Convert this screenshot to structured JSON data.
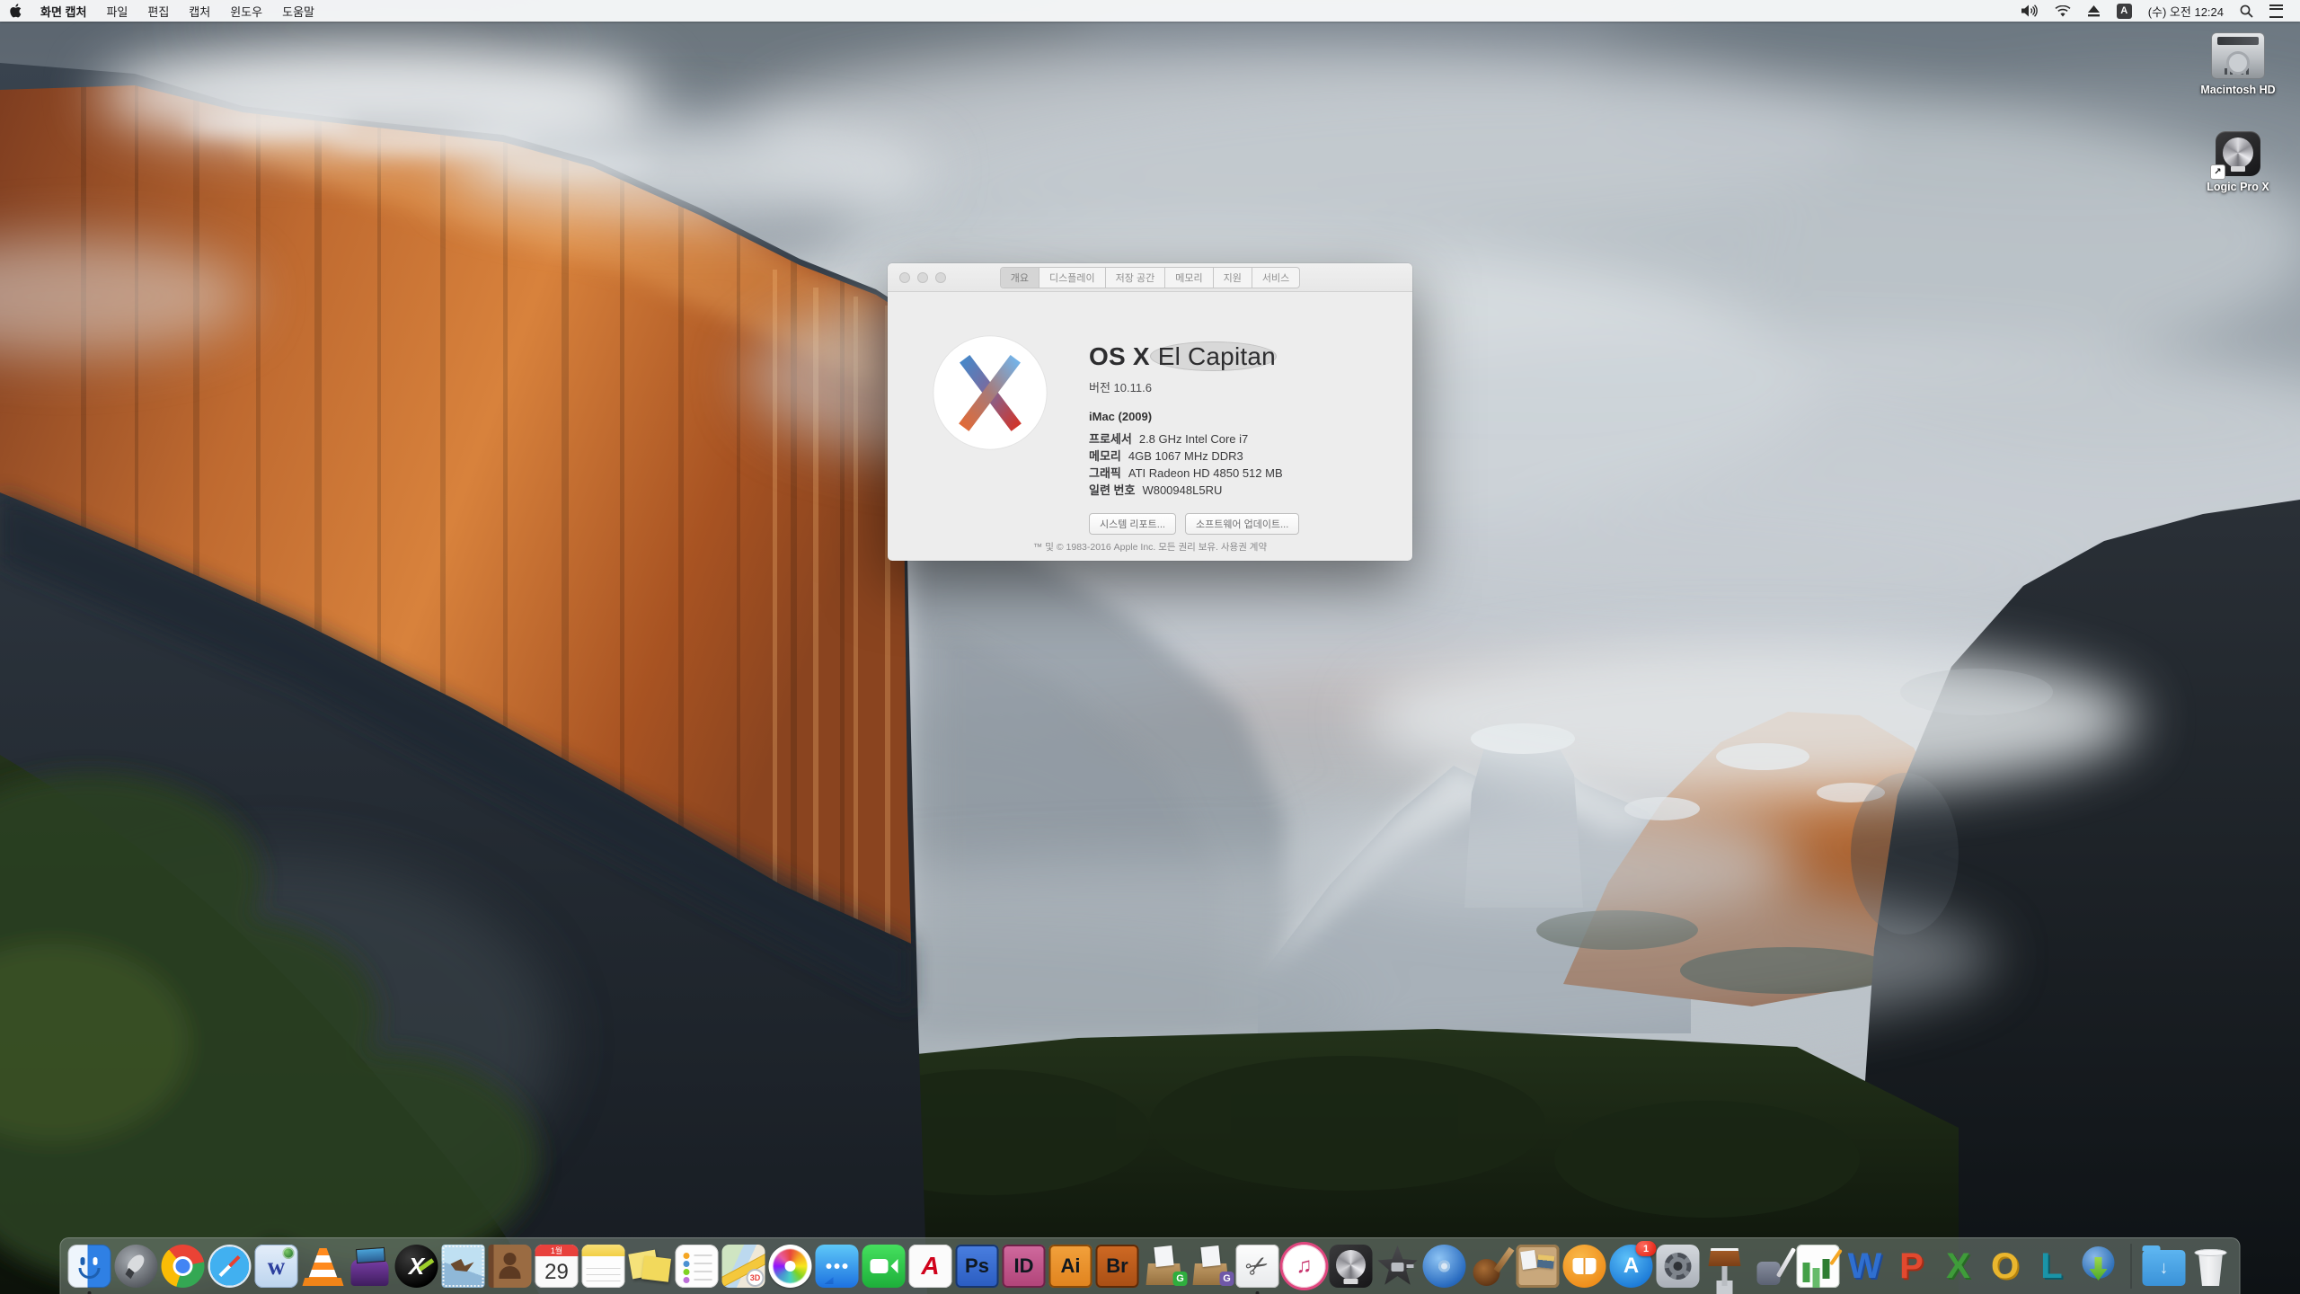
{
  "menu_bar": {
    "apple_icon": "apple-logo",
    "menus": [
      {
        "label": "화면 캡처",
        "app_menu": true
      },
      {
        "label": "파일",
        "app_menu": false
      },
      {
        "label": "편집",
        "app_menu": false
      },
      {
        "label": "캡처",
        "app_menu": false
      },
      {
        "label": "윈도우",
        "app_menu": false
      },
      {
        "label": "도움말",
        "app_menu": false
      }
    ],
    "status": {
      "input_source": "A",
      "clock": "(수) 오전 12:24"
    }
  },
  "desktop": {
    "icons": [
      {
        "name": "macintosh-hd",
        "type": "hdd",
        "label": "Macintosh HD"
      },
      {
        "name": "logic-pro-x-alias",
        "type": "logic-alias",
        "label": "Logic Pro X"
      }
    ]
  },
  "about_window": {
    "tabs": [
      {
        "label": "개요",
        "selected": true
      },
      {
        "label": "디스플레이",
        "selected": false
      },
      {
        "label": "저장 공간",
        "selected": false
      },
      {
        "label": "메모리",
        "selected": false
      },
      {
        "label": "지원",
        "selected": false
      },
      {
        "label": "서비스",
        "selected": false
      }
    ],
    "title_strong": "OS X",
    "title_light": " El Capitan",
    "version": "버전 10.11.6",
    "model": "iMac (2009)",
    "specs": [
      {
        "label": "프로세서",
        "value": "2.8 GHz Intel Core i7"
      },
      {
        "label": "메모리",
        "value": "4GB 1067 MHz DDR3"
      },
      {
        "label": "그래픽",
        "value": "ATI Radeon HD 4850 512 MB"
      },
      {
        "label": "일련 번호",
        "value": "W800948L5RU"
      }
    ],
    "buttons": [
      {
        "name": "system-report-button",
        "label": "시스템 리포트..."
      },
      {
        "name": "software-update-button",
        "label": "소프트웨어 업데이트..."
      }
    ],
    "footer": "™ 및 © 1983-2016 Apple Inc. 모든 권리 보유. 사용권 계약"
  },
  "dock": {
    "items": [
      {
        "name": "finder",
        "type": "finder",
        "running": true
      },
      {
        "name": "launchpad",
        "type": "launchpad"
      },
      {
        "name": "chrome",
        "type": "chrome"
      },
      {
        "name": "safari",
        "type": "safari"
      },
      {
        "name": "w-globe-browser",
        "type": "wglobe",
        "glyph": "w"
      },
      {
        "name": "vlc",
        "type": "vlc"
      },
      {
        "name": "toast-titanium",
        "type": "toast"
      },
      {
        "name": "x-app",
        "type": "xapp",
        "glyph": "X"
      },
      {
        "name": "mail",
        "type": "mail"
      },
      {
        "name": "contacts",
        "type": "contacts"
      },
      {
        "name": "calendar",
        "type": "calendar",
        "month": "1월",
        "day": "29"
      },
      {
        "name": "notes",
        "type": "notes"
      },
      {
        "name": "stickies",
        "type": "stickies"
      },
      {
        "name": "reminders",
        "type": "reminders"
      },
      {
        "name": "maps",
        "type": "maps",
        "glyph": "3D"
      },
      {
        "name": "photos",
        "type": "photos"
      },
      {
        "name": "messages",
        "type": "messages"
      },
      {
        "name": "facetime",
        "type": "facetime"
      },
      {
        "name": "acrobat",
        "type": "acrobat",
        "glyph": "A"
      },
      {
        "name": "photoshop",
        "type": "adobe-ps",
        "glyph": "Ps"
      },
      {
        "name": "indesign",
        "type": "adobe-id",
        "glyph": "ID"
      },
      {
        "name": "illustrator",
        "type": "adobe-ai",
        "glyph": "Ai"
      },
      {
        "name": "bridge",
        "type": "adobe-br",
        "glyph": "Br"
      },
      {
        "name": "archiver-compress",
        "type": "boxg",
        "corner_badge": "G",
        "badge_color": "green"
      },
      {
        "name": "archiver-expand",
        "type": "boxg2",
        "corner_badge": "G",
        "badge_color": "purple"
      },
      {
        "name": "grab-screen-capture",
        "type": "grab",
        "running": true,
        "glyph_icon": "scissors"
      },
      {
        "name": "itunes",
        "type": "itunes",
        "glyph_icon": "music-note"
      },
      {
        "name": "logic-pro-x",
        "type": "logic"
      },
      {
        "name": "imovie",
        "type": "imovie"
      },
      {
        "name": "idvd",
        "type": "idvd"
      },
      {
        "name": "garageband",
        "type": "garageband"
      },
      {
        "name": "corkboard-collage-app",
        "type": "corkboard"
      },
      {
        "name": "ibooks",
        "type": "ibooks"
      },
      {
        "name": "app-store",
        "type": "appstore",
        "glyph": "A",
        "badge": "1"
      },
      {
        "name": "system-preferences",
        "type": "sysprefs"
      },
      {
        "name": "keynote",
        "type": "keynote"
      },
      {
        "name": "pages",
        "type": "pages"
      },
      {
        "name": "numbers",
        "type": "numbers"
      },
      {
        "name": "ms-word",
        "type": "msword",
        "glyph": "W"
      },
      {
        "name": "ms-powerpoint",
        "type": "msppt",
        "glyph": "P"
      },
      {
        "name": "ms-excel",
        "type": "msexcel",
        "glyph": "X"
      },
      {
        "name": "ms-outlook",
        "type": "msoutlook",
        "glyph": "O"
      },
      {
        "name": "ms-lync",
        "type": "mslync",
        "glyph": "L"
      },
      {
        "name": "web-downloader",
        "type": "downloader"
      },
      {
        "name": "separator",
        "type": "separator"
      },
      {
        "name": "downloads-folder",
        "type": "downloads",
        "glyph_icon": "down-arrow"
      },
      {
        "name": "trash",
        "type": "trash"
      }
    ]
  },
  "icon_glyphs": {
    "scissors": "✂",
    "music-note": "♫",
    "down-arrow": "↓",
    "alias-arrow": "↗"
  },
  "colors": {
    "menubar_bg": "#f6f7f8",
    "dock_bg": "rgba(112,124,116,0.62)",
    "selected_tab_bg": "#d5d5d5",
    "badge_red": "#dd1606",
    "x_logo_blue_dark": "#4887c8",
    "x_logo_blue_light": "#74b3e8",
    "x_logo_red": "#d0352b",
    "x_logo_orange": "#e06a38"
  }
}
